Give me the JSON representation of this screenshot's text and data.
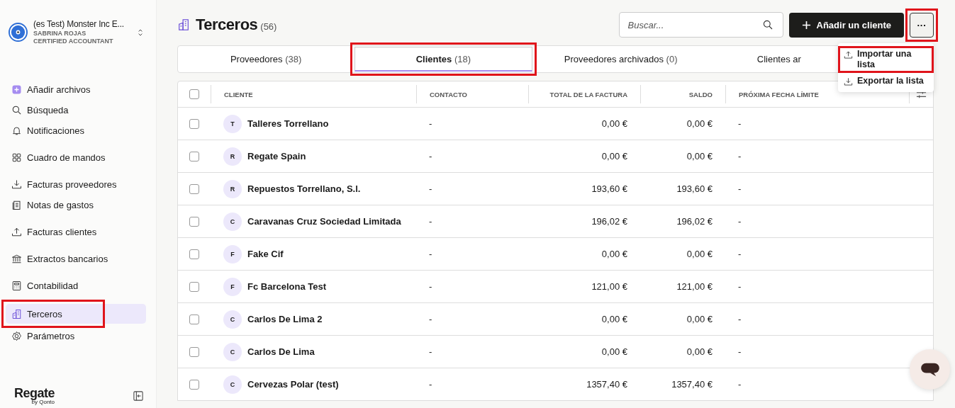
{
  "workspace": {
    "name": "(es Test) Monster Inc E...",
    "user": "SABRINA ROJAS",
    "role": "CERTIFIED ACCOUNTANT"
  },
  "sidebar": {
    "groups": [
      [
        {
          "label": "Añadir archivos",
          "selected": false,
          "highlighted": false
        },
        {
          "label": "Búsqueda",
          "selected": false,
          "highlighted": false
        },
        {
          "label": "Notificaciones",
          "selected": false,
          "highlighted": false
        }
      ],
      [
        {
          "label": "Cuadro de mandos",
          "selected": false,
          "highlighted": false
        }
      ],
      [
        {
          "label": "Facturas proveedores",
          "selected": false,
          "highlighted": false
        },
        {
          "label": "Notas de gastos",
          "selected": false,
          "highlighted": false
        }
      ],
      [
        {
          "label": "Facturas clientes",
          "selected": false,
          "highlighted": false
        }
      ],
      [
        {
          "label": "Extractos bancarios",
          "selected": false,
          "highlighted": false
        }
      ],
      [
        {
          "label": "Contabilidad",
          "selected": false,
          "highlighted": false
        }
      ],
      [
        {
          "label": "Terceros",
          "selected": true,
          "highlighted": true
        },
        {
          "label": "Parámetros",
          "selected": false,
          "highlighted": false
        }
      ]
    ],
    "brand": "Regate",
    "brand_sub": "by Qonto"
  },
  "page": {
    "title": "Terceros",
    "count": "(56)",
    "search": {
      "placeholder": "Buscar..."
    },
    "add_button": "Añadir un cliente",
    "more_button": {
      "label": "···",
      "highlighted": true
    }
  },
  "tabs": [
    {
      "label": "Proveedores",
      "count": "(38)",
      "selected": false,
      "highlighted": false
    },
    {
      "label": "Clientes",
      "count": "(18)",
      "selected": true,
      "highlighted": true
    },
    {
      "label": "Proveedores archivados",
      "count": "(0)",
      "selected": false,
      "highlighted": false
    },
    {
      "label": "Clientes ar",
      "selected": false,
      "highlighted": false
    }
  ],
  "menu": [
    {
      "label": "Importar una lista",
      "highlighted": true
    },
    {
      "label": "Exportar la lista",
      "highlighted": false
    }
  ],
  "table": {
    "all_selected": false,
    "columns": [
      "CLIENTE",
      "CONTACTO",
      "TOTAL DE LA FACTURA",
      "SALDO",
      "PRÓXIMA FECHA LÍMITE"
    ],
    "rows": [
      {
        "checked": false,
        "initial": "T",
        "name": "Talleres Torrellano",
        "contact": "-",
        "total": "0,00 €",
        "balance": "0,00 €",
        "due": "-"
      },
      {
        "checked": false,
        "initial": "R",
        "name": "Regate Spain",
        "contact": "-",
        "total": "0,00 €",
        "balance": "0,00 €",
        "due": "-"
      },
      {
        "checked": false,
        "initial": "R",
        "name": "Repuestos Torrellano, S.l.",
        "contact": "-",
        "total": "193,60 €",
        "balance": "193,60 €",
        "due": "-"
      },
      {
        "checked": false,
        "initial": "C",
        "name": "Caravanas Cruz Sociedad Limitada",
        "contact": "-",
        "total": "196,02 €",
        "balance": "196,02 €",
        "due": "-"
      },
      {
        "checked": false,
        "initial": "F",
        "name": "Fake Cif",
        "contact": "-",
        "total": "0,00 €",
        "balance": "0,00 €",
        "due": "-"
      },
      {
        "checked": false,
        "initial": "F",
        "name": "Fc Barcelona Test",
        "contact": "-",
        "total": "121,00 €",
        "balance": "121,00 €",
        "due": "-"
      },
      {
        "checked": false,
        "initial": "C",
        "name": "Carlos De Lima 2",
        "contact": "-",
        "total": "0,00 €",
        "balance": "0,00 €",
        "due": "-"
      },
      {
        "checked": false,
        "initial": "C",
        "name": "Carlos De Lima",
        "contact": "-",
        "total": "0,00 €",
        "balance": "0,00 €",
        "due": "-"
      },
      {
        "checked": false,
        "initial": "C",
        "name": "Cervezas Polar (test)",
        "contact": "-",
        "total": "1357,40 €",
        "balance": "1357,40 €",
        "due": "-"
      }
    ]
  }
}
